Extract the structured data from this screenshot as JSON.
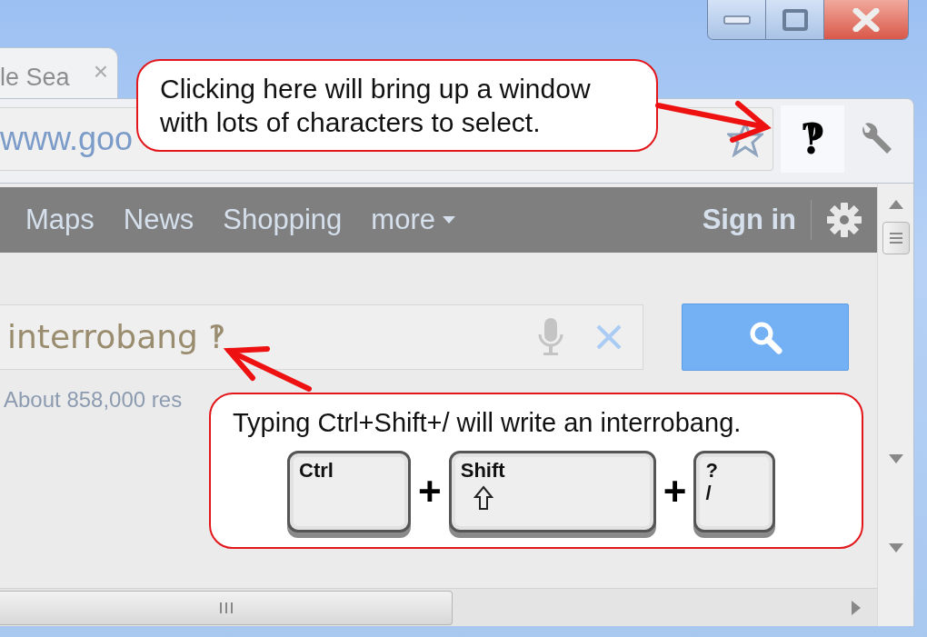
{
  "tab": {
    "title": "le Sea",
    "close": "×"
  },
  "toolbar": {
    "address": "www.goo",
    "bookmarked": false,
    "char_button": "‽"
  },
  "google_bar": {
    "links": [
      {
        "label": "Maps",
        "has_menu": false
      },
      {
        "label": "News",
        "has_menu": false
      },
      {
        "label": "Shopping",
        "has_menu": false
      },
      {
        "label": "more",
        "has_menu": true
      }
    ],
    "sign_in": "Sign in"
  },
  "search": {
    "value": "interrobang ‽",
    "results": "About 858,000 res"
  },
  "callouts": [
    {
      "kind": "text",
      "text": "Clicking here will bring up a window with lots of characters to select."
    },
    {
      "kind": "keys",
      "text": "Typing Ctrl+Shift+/ will write an interrobang.",
      "keys": [
        {
          "kind": "key",
          "label": "Ctrl"
        },
        {
          "kind": "plus",
          "label": "+"
        },
        {
          "kind": "shift",
          "label": "Shift"
        },
        {
          "kind": "plus",
          "label": "+"
        },
        {
          "kind": "dual",
          "top": "?",
          "bottom": "/"
        }
      ]
    }
  ]
}
